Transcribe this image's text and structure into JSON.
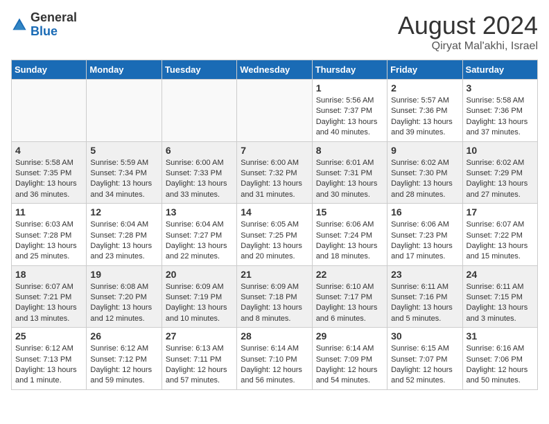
{
  "header": {
    "logo_general": "General",
    "logo_blue": "Blue",
    "month": "August 2024",
    "location": "Qiryat Mal'akhi, Israel"
  },
  "weekdays": [
    "Sunday",
    "Monday",
    "Tuesday",
    "Wednesday",
    "Thursday",
    "Friday",
    "Saturday"
  ],
  "weeks": [
    [
      {
        "day": "",
        "info": ""
      },
      {
        "day": "",
        "info": ""
      },
      {
        "day": "",
        "info": ""
      },
      {
        "day": "",
        "info": ""
      },
      {
        "day": "1",
        "info": "Sunrise: 5:56 AM\nSunset: 7:37 PM\nDaylight: 13 hours\nand 40 minutes."
      },
      {
        "day": "2",
        "info": "Sunrise: 5:57 AM\nSunset: 7:36 PM\nDaylight: 13 hours\nand 39 minutes."
      },
      {
        "day": "3",
        "info": "Sunrise: 5:58 AM\nSunset: 7:36 PM\nDaylight: 13 hours\nand 37 minutes."
      }
    ],
    [
      {
        "day": "4",
        "info": "Sunrise: 5:58 AM\nSunset: 7:35 PM\nDaylight: 13 hours\nand 36 minutes."
      },
      {
        "day": "5",
        "info": "Sunrise: 5:59 AM\nSunset: 7:34 PM\nDaylight: 13 hours\nand 34 minutes."
      },
      {
        "day": "6",
        "info": "Sunrise: 6:00 AM\nSunset: 7:33 PM\nDaylight: 13 hours\nand 33 minutes."
      },
      {
        "day": "7",
        "info": "Sunrise: 6:00 AM\nSunset: 7:32 PM\nDaylight: 13 hours\nand 31 minutes."
      },
      {
        "day": "8",
        "info": "Sunrise: 6:01 AM\nSunset: 7:31 PM\nDaylight: 13 hours\nand 30 minutes."
      },
      {
        "day": "9",
        "info": "Sunrise: 6:02 AM\nSunset: 7:30 PM\nDaylight: 13 hours\nand 28 minutes."
      },
      {
        "day": "10",
        "info": "Sunrise: 6:02 AM\nSunset: 7:29 PM\nDaylight: 13 hours\nand 27 minutes."
      }
    ],
    [
      {
        "day": "11",
        "info": "Sunrise: 6:03 AM\nSunset: 7:28 PM\nDaylight: 13 hours\nand 25 minutes."
      },
      {
        "day": "12",
        "info": "Sunrise: 6:04 AM\nSunset: 7:28 PM\nDaylight: 13 hours\nand 23 minutes."
      },
      {
        "day": "13",
        "info": "Sunrise: 6:04 AM\nSunset: 7:27 PM\nDaylight: 13 hours\nand 22 minutes."
      },
      {
        "day": "14",
        "info": "Sunrise: 6:05 AM\nSunset: 7:25 PM\nDaylight: 13 hours\nand 20 minutes."
      },
      {
        "day": "15",
        "info": "Sunrise: 6:06 AM\nSunset: 7:24 PM\nDaylight: 13 hours\nand 18 minutes."
      },
      {
        "day": "16",
        "info": "Sunrise: 6:06 AM\nSunset: 7:23 PM\nDaylight: 13 hours\nand 17 minutes."
      },
      {
        "day": "17",
        "info": "Sunrise: 6:07 AM\nSunset: 7:22 PM\nDaylight: 13 hours\nand 15 minutes."
      }
    ],
    [
      {
        "day": "18",
        "info": "Sunrise: 6:07 AM\nSunset: 7:21 PM\nDaylight: 13 hours\nand 13 minutes."
      },
      {
        "day": "19",
        "info": "Sunrise: 6:08 AM\nSunset: 7:20 PM\nDaylight: 13 hours\nand 12 minutes."
      },
      {
        "day": "20",
        "info": "Sunrise: 6:09 AM\nSunset: 7:19 PM\nDaylight: 13 hours\nand 10 minutes."
      },
      {
        "day": "21",
        "info": "Sunrise: 6:09 AM\nSunset: 7:18 PM\nDaylight: 13 hours\nand 8 minutes."
      },
      {
        "day": "22",
        "info": "Sunrise: 6:10 AM\nSunset: 7:17 PM\nDaylight: 13 hours\nand 6 minutes."
      },
      {
        "day": "23",
        "info": "Sunrise: 6:11 AM\nSunset: 7:16 PM\nDaylight: 13 hours\nand 5 minutes."
      },
      {
        "day": "24",
        "info": "Sunrise: 6:11 AM\nSunset: 7:15 PM\nDaylight: 13 hours\nand 3 minutes."
      }
    ],
    [
      {
        "day": "25",
        "info": "Sunrise: 6:12 AM\nSunset: 7:13 PM\nDaylight: 13 hours\nand 1 minute."
      },
      {
        "day": "26",
        "info": "Sunrise: 6:12 AM\nSunset: 7:12 PM\nDaylight: 12 hours\nand 59 minutes."
      },
      {
        "day": "27",
        "info": "Sunrise: 6:13 AM\nSunset: 7:11 PM\nDaylight: 12 hours\nand 57 minutes."
      },
      {
        "day": "28",
        "info": "Sunrise: 6:14 AM\nSunset: 7:10 PM\nDaylight: 12 hours\nand 56 minutes."
      },
      {
        "day": "29",
        "info": "Sunrise: 6:14 AM\nSunset: 7:09 PM\nDaylight: 12 hours\nand 54 minutes."
      },
      {
        "day": "30",
        "info": "Sunrise: 6:15 AM\nSunset: 7:07 PM\nDaylight: 12 hours\nand 52 minutes."
      },
      {
        "day": "31",
        "info": "Sunrise: 6:16 AM\nSunset: 7:06 PM\nDaylight: 12 hours\nand 50 minutes."
      }
    ]
  ]
}
